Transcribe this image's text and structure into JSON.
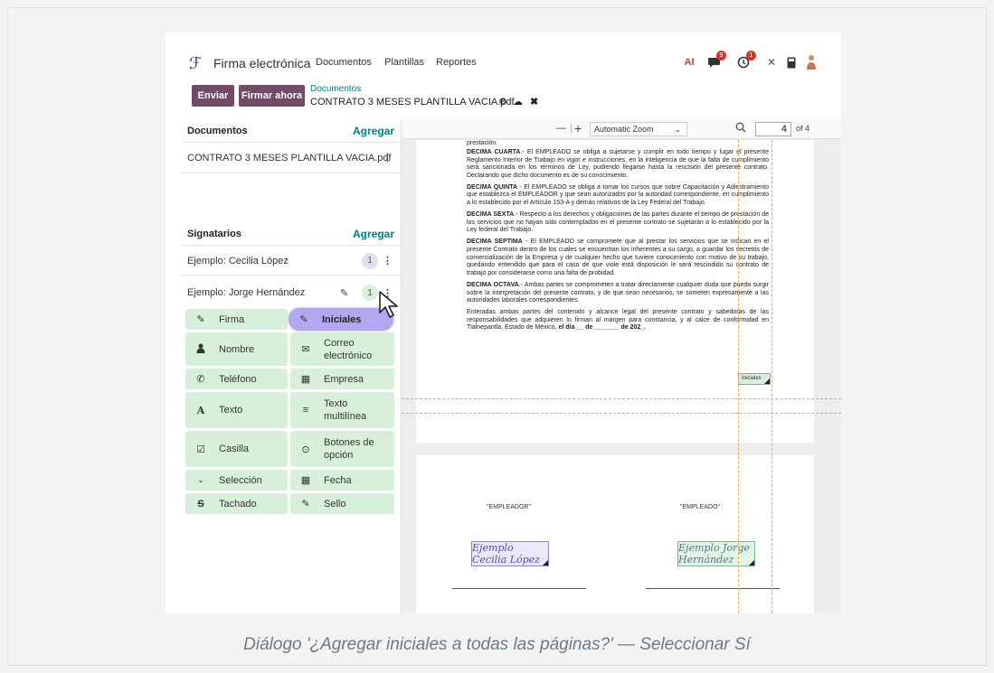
{
  "topnav": {
    "app_name": "Firma electrónica",
    "menu": [
      "Documentos",
      "Plantillas",
      "Reportes"
    ],
    "logo_glyph": "ℱ",
    "ai_label": "AI",
    "chat_badge": "9",
    "activity_badge": "1"
  },
  "controls": {
    "send_label": "Enviar",
    "sign_now_label": "Firmar ahora",
    "breadcrumb_parent": "Documentos",
    "breadcrumb_current": "CONTRATO 3 MESES PLANTILLA VACIA.pdf"
  },
  "documents_section": {
    "title": "Documentos",
    "add_label": "Agregar",
    "file_name": "CONTRATO 3 MESES PLANTILLA VACIA.pdf"
  },
  "signers_section": {
    "title": "Signatarios",
    "add_label": "Agregar",
    "signers": [
      {
        "name": "Ejemplo: Cecilia López",
        "count": "1"
      },
      {
        "name": "Ejemplo: Jorge Hernández",
        "count": "1"
      }
    ]
  },
  "field_types": {
    "firma": "Firma",
    "iniciales": "Iniciales",
    "nombre": "Nombre",
    "correo": "Correo electrónico",
    "telefono": "Teléfono",
    "empresa": "Empresa",
    "texto": "Texto",
    "texto_multilinea": "Texto multilínea",
    "casilla": "Casilla",
    "botones_opcion": "Botones de opción",
    "seleccion": "Selección",
    "fecha": "Fecha",
    "tachado": "Tachado",
    "sello": "Sello"
  },
  "viewer": {
    "zoom": "Automatic Zoom",
    "page_current": "4",
    "page_total": "of 4"
  },
  "document_text": {
    "top_fragment": "prestación.",
    "clauses": [
      {
        "head": "DECIMA CUARTA",
        "body": ".- El EMPLEADO se obliga a sujetarse y cumplir en todo tiempo y lugar el presente Reglamento Interior de Trabajo en vigor e instrucciones, en la inteligencia de que la falta de cumplimiento será sancionada en los términos de Ley, pudiendo llegarse hasta la rescisión del presente contrato. Declarando que dicho documento es de su conocimiento."
      },
      {
        "head": "DECIMA QUINTA",
        "body": " - El EMPLEADO se obliga a tomar los cursos que sobre Capacitación y Adiestramiento que establezca el EMPLEADOR y que sean autorizados por la autoridad correspondiente, en cumplimiento a lo establecido por el Artículo 153-A y demás relativos de la Ley Federal del Trabajo."
      },
      {
        "head": "DECIMA SEXTA",
        "body": ".- Respecto a los derechos y obligaciones de las partes durante el tiempo de prestación de los servicios que no hayan sido contemplados en el presente contrato se sujetarán a lo establecido por la Ley federal del Trabajo."
      },
      {
        "head": "DECIMA SEPTIMA",
        "body": " - El EMPLEADO se compromete que al prestar los servicios que se indican en el presente Contrato dentro de los cuales se encuentran los inherentes a su cargo, a guardar los secretos de comercialización de la Empresa y de cualquier hecho que tuviere conocimiento con motivo de su trabajo, quedando entendido que para el caso de que viole está disposición le será rescindido su contrato de trabajo por considerarse como una falta de probidad."
      },
      {
        "head": "DECIMA OCTAVA",
        "body": ".- Ambas partes se comprometen a tratar directamente cualquier duda que pueda surgir sobre la interpretación del presente contrato, y de que sean necesarios, se someten expresamente a las autoridades laborales correspondientes."
      }
    ],
    "closing_prefix": "Enteradas ambas partes del contenido y alcance legal del presente contrato y sabedoras de las responsabilidades que adquieren lo firman al margen para constancia, y al calce de conformidad en Tlalnepantla, Estado de México, ",
    "closing_date": "el día __ de _______ de 202_.",
    "initials_tag": "Iniciales",
    "employer_label": "\"EMPLEADOR\"",
    "employee_label": "\"EMPLEADO\"",
    "signature_1": "Ejemplo Cecilia López",
    "signature_2": "Ejemplo Jorge Hernández"
  },
  "caption": "Diálogo '¿Agregar iniciales a todas las páginas?' — Seleccionar Sí",
  "colors": {
    "primary": "#714b67",
    "accent": "#017e84",
    "field_bg": "#d8f0da",
    "field_highlight": "#b3a8ef",
    "guide": "#f0a95a"
  }
}
